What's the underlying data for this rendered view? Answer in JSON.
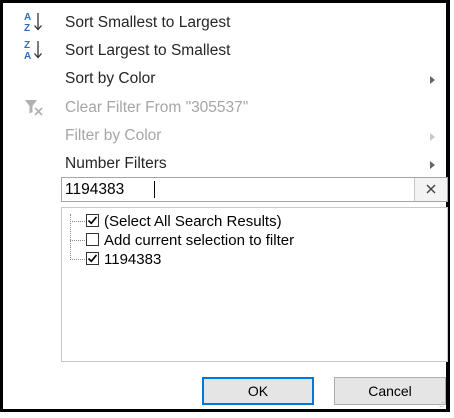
{
  "menu": {
    "sort_asc": {
      "label": "Sort Smallest to Largest",
      "icon": "sort-ascending-icon"
    },
    "sort_desc": {
      "label": "Sort Largest to Smallest",
      "icon": "sort-descending-icon"
    },
    "sort_color": {
      "label": "Sort by Color"
    },
    "clear_filter": {
      "label": "Clear Filter From \"305537\"",
      "icon": "clear-filter-icon"
    },
    "filter_color": {
      "label": "Filter by Color"
    },
    "number_filters": {
      "label": "Number Filters"
    }
  },
  "search": {
    "value": "1194383",
    "clear_icon": "clear-search-icon"
  },
  "list": {
    "items": [
      {
        "label": "(Select All Search Results)",
        "checked": true
      },
      {
        "label": "Add current selection to filter",
        "checked": false
      },
      {
        "label": "1194383",
        "checked": true
      }
    ]
  },
  "buttons": {
    "ok": "OK",
    "cancel": "Cancel"
  },
  "colors": {
    "accent": "#0078d7",
    "sort_icon_blue": "#2f6eba",
    "disabled_text": "#a6a6a6"
  }
}
